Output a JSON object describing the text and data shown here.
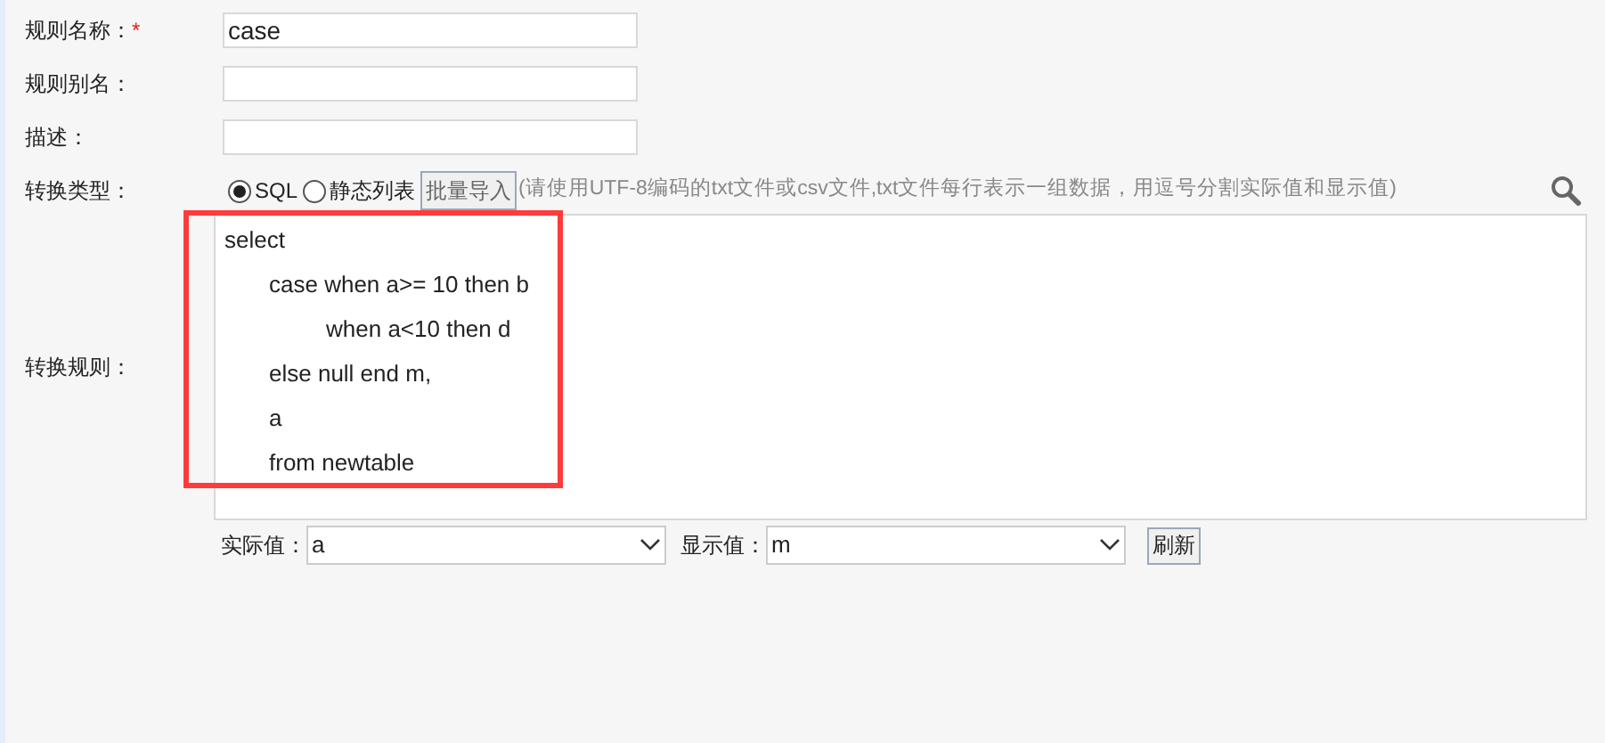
{
  "fields": [
    {
      "label": "规则名称：",
      "required_mark": "*",
      "value": "case"
    },
    {
      "label": "规则别名："
    },
    {
      "label": "描述："
    }
  ],
  "conversion_type": {
    "label": "转换类型：",
    "options": [
      {
        "label": "SQL",
        "selected": true
      },
      {
        "label": "静态列表",
        "selected": false
      }
    ],
    "import_button": "批量导入",
    "hint": "(请使用UTF-8编码的txt文件或csv文件,txt文件每行表示一组数据，用逗号分割实际值和显示值)"
  },
  "rule": {
    "label": "转换规则：",
    "lines": [
      {
        "text": "select",
        "children": [
          {
            "text": "case when a>= 10 then b",
            "children": [
              {
                "text": "when a<10 then d"
              }
            ]
          },
          {
            "text": "else null end m,"
          },
          {
            "text": "a"
          },
          {
            "text": "from newtable"
          }
        ]
      }
    ]
  },
  "mapping": {
    "actual_label": "实际值：",
    "actual_value": "a",
    "display_label": "显示值：",
    "display_value": "m",
    "refresh_button": "刷新"
  }
}
